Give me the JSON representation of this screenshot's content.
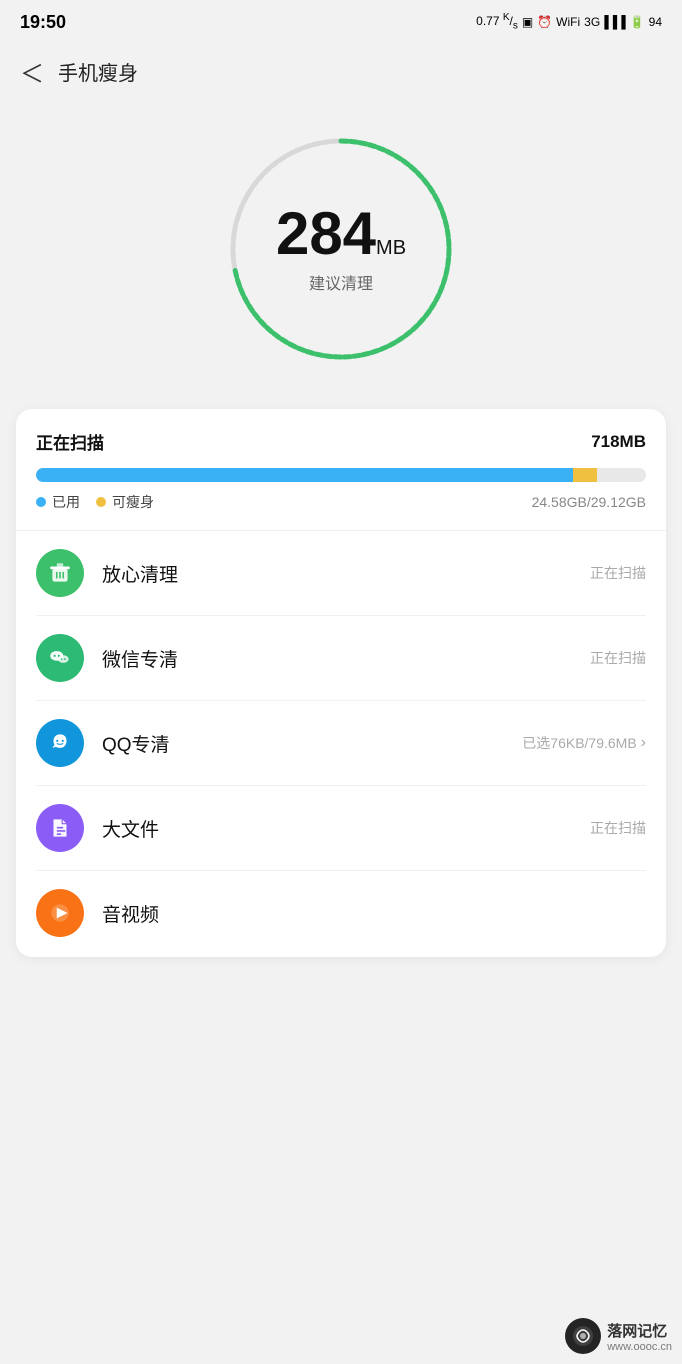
{
  "statusBar": {
    "time": "19:50",
    "network": "0.77 ᴷ/ₛ",
    "battery": "94"
  },
  "header": {
    "back": "‹",
    "title": "手机瘦身"
  },
  "gauge": {
    "value": "284",
    "unit": "MB",
    "label": "建议清理",
    "totalDashes": 60,
    "activeDashes": 48
  },
  "scanCard": {
    "title": "正在扫描",
    "size": "718MB",
    "progressBlue": 88,
    "progressYellow": 4,
    "legend": {
      "used": "已用",
      "slim": "可瘦身",
      "storage": "24.58GB/29.12GB"
    }
  },
  "listItems": [
    {
      "id": "safe-clean",
      "name": "放心清理",
      "iconColor": "icon-green",
      "iconType": "trash",
      "status": "正在扫描",
      "hasArrow": false
    },
    {
      "id": "wechat-clean",
      "name": "微信专清",
      "iconColor": "icon-teal",
      "iconType": "wechat",
      "status": "正在扫描",
      "hasArrow": false
    },
    {
      "id": "qq-clean",
      "name": "QQ专清",
      "iconColor": "icon-blue",
      "iconType": "qq",
      "status": "已选76KB/79.6MB",
      "hasArrow": true
    },
    {
      "id": "large-file",
      "name": "大文件",
      "iconColor": "icon-purple",
      "iconType": "file",
      "status": "正在扫描",
      "hasArrow": false
    },
    {
      "id": "media",
      "name": "音视频",
      "iconColor": "icon-orange",
      "iconType": "play",
      "status": "",
      "hasArrow": false
    }
  ],
  "watermark": {
    "site": "落网记忆",
    "url": "www.oooc.cn"
  }
}
